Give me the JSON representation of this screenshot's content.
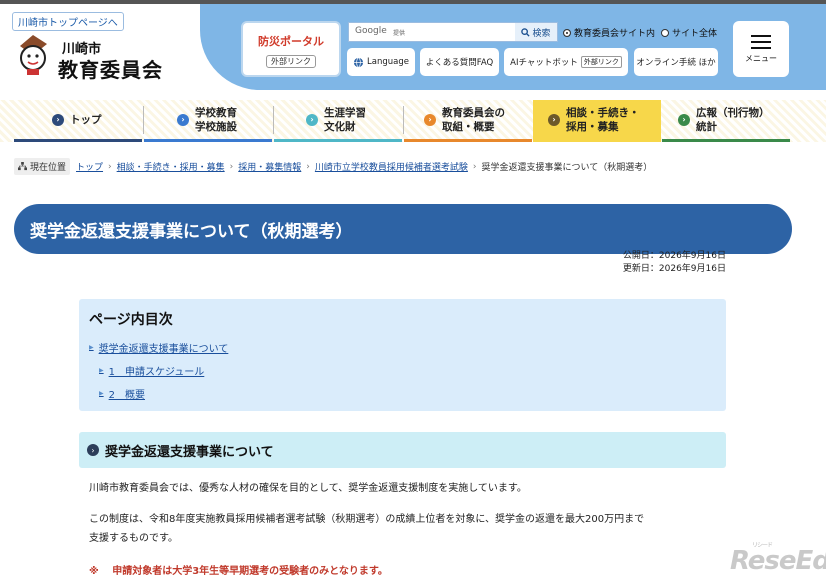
{
  "header": {
    "top_link": "川崎市トップページへ",
    "logo_line1": "川崎市",
    "logo_line2": "教育委員会",
    "disaster_portal": "防災ポータル",
    "external_link": "外部リンク",
    "search_brand": "Google",
    "search_powered": "提供",
    "search_button": "検索",
    "radio_site": "教育委員会サイト内",
    "radio_all": "サイト全体",
    "language": "Language",
    "faq": "よくある質問FAQ",
    "ai_chat": "AIチャットボット",
    "ai_chat_ext": "外部リンク",
    "online": "オンライン手続 ほか",
    "menu": "メニュー"
  },
  "gnav": [
    {
      "label": "トップ",
      "color": "#2d4a7a"
    },
    {
      "label1": "学校教育",
      "label2": "学校施設",
      "color": "#3a7ad0"
    },
    {
      "label1": "生涯学習",
      "label2": "文化財",
      "color": "#4fb7c7"
    },
    {
      "label1": "教育委員会の",
      "label2": "取組・概要",
      "color": "#e8882c"
    },
    {
      "label1": "相談・手続き・",
      "label2": "採用・募集",
      "color": "#6d5a2a"
    },
    {
      "label1": "広報（刊行物）",
      "label2": "統計",
      "color": "#3a8a4a"
    }
  ],
  "breadcrumb": {
    "here": "現在位置",
    "items": [
      "トップ",
      "相談・手続き・採用・募集",
      "採用・募集情報",
      "川崎市立学校教員採用候補者選考試験"
    ],
    "current": "奨学金返還支援事業について（秋期選考）"
  },
  "page_title": "奨学金返還支援事業について（秋期選考）",
  "dates": {
    "published": "公開日：2026年9月16日",
    "updated": "更新日：2026年9月16日"
  },
  "toc": {
    "heading": "ページ内目次",
    "items": [
      "奨学金返還支援事業について",
      "1　申請スケジュール",
      "2　概要"
    ]
  },
  "section": {
    "heading": "奨学金返還支援事業について",
    "p1": "川崎市教育委員会では、優秀な人材の確保を目的として、奨学金返還支援制度を実施しています。",
    "p2a": "この制度は、令和8年度実施教員採用候補者選考試験（秋期選考）の成績上位者を対象に、奨学金の返還を最大200万円まで",
    "p2b": "支援するものです。",
    "note_mark": "※",
    "note": "申請対象者は大学3年生等早期選考の受験者のみとなります。"
  },
  "watermark": "ReseEd",
  "watermark_small": "リシード"
}
